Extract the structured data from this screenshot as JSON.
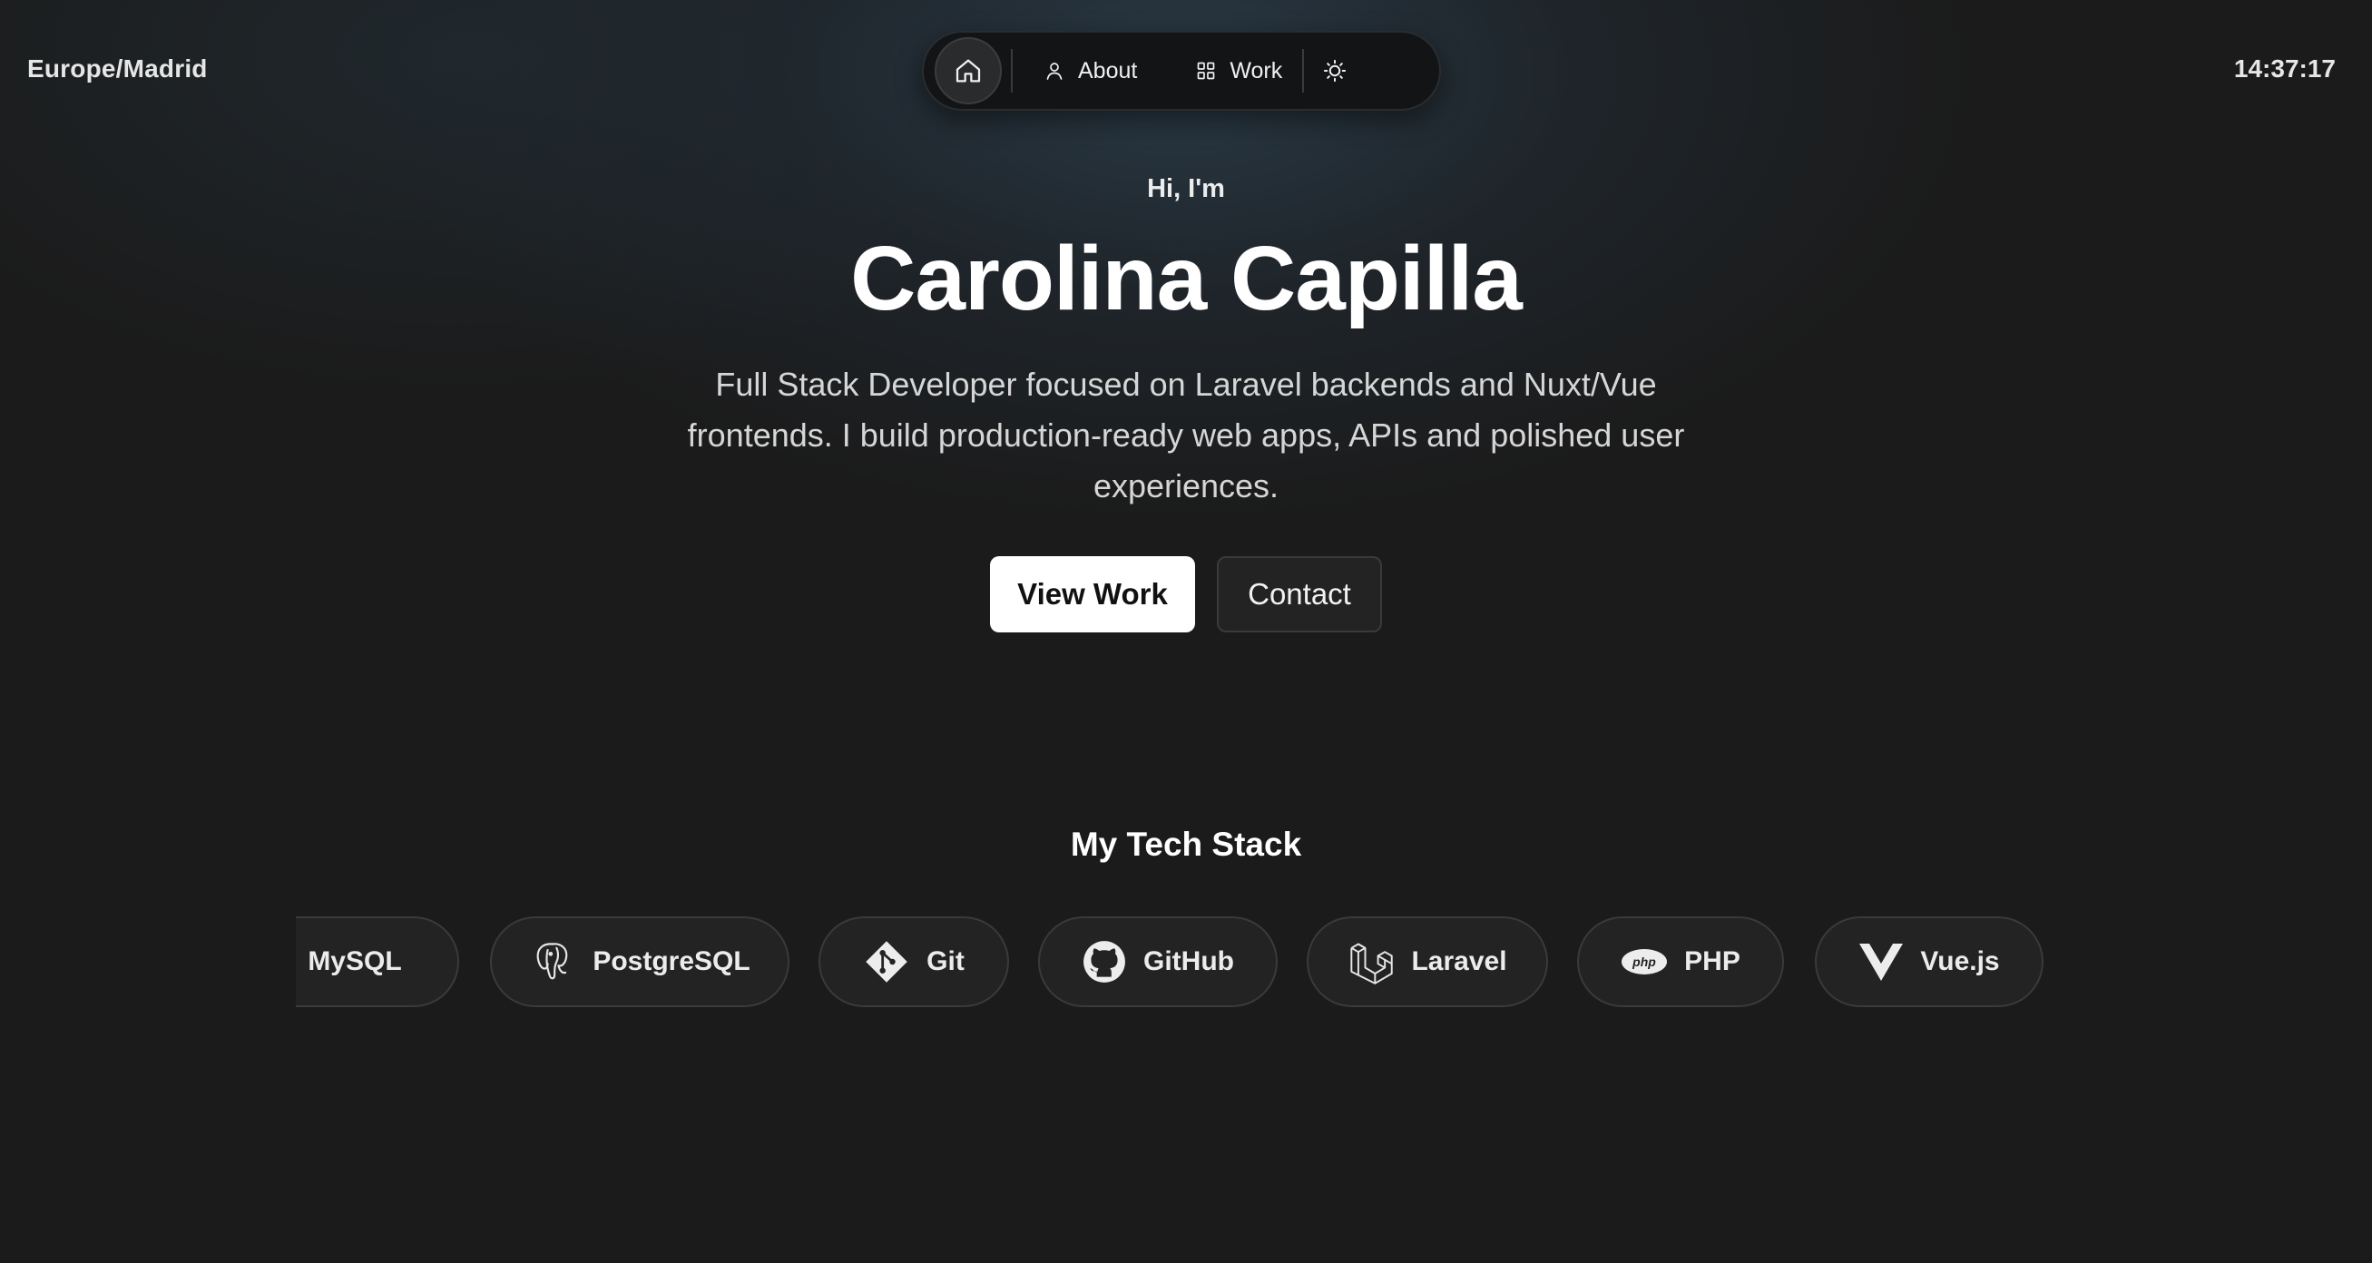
{
  "header": {
    "timezone": "Europe/Madrid",
    "clock": "14:37:17"
  },
  "nav": {
    "home_icon": "home-icon",
    "items": [
      {
        "label": "About",
        "icon": "user-icon"
      },
      {
        "label": "Work",
        "icon": "grid-icon"
      }
    ],
    "theme_icon": "sun-icon"
  },
  "hero": {
    "greeting": "Hi, I'm",
    "name": "Carolina Capilla",
    "intro": "Full Stack Developer focused on Laravel backends and Nuxt/Vue frontends. I build production-ready web apps, APIs and polished user experiences.",
    "primary_button": "View Work",
    "secondary_button": "Contact"
  },
  "tech_stack": {
    "title": "My Tech Stack",
    "items": [
      {
        "label": "MySQL",
        "icon": "mysql-icon"
      },
      {
        "label": "PostgreSQL",
        "icon": "postgresql-icon"
      },
      {
        "label": "Git",
        "icon": "git-icon"
      },
      {
        "label": "GitHub",
        "icon": "github-icon"
      },
      {
        "label": "Laravel",
        "icon": "laravel-icon"
      },
      {
        "label": "PHP",
        "icon": "php-icon"
      },
      {
        "label": "Vue.js",
        "icon": "vuejs-icon"
      }
    ]
  },
  "colors": {
    "background": "#1b1b1b",
    "accent_button": "#ffffff",
    "pill_background": "#232323"
  }
}
